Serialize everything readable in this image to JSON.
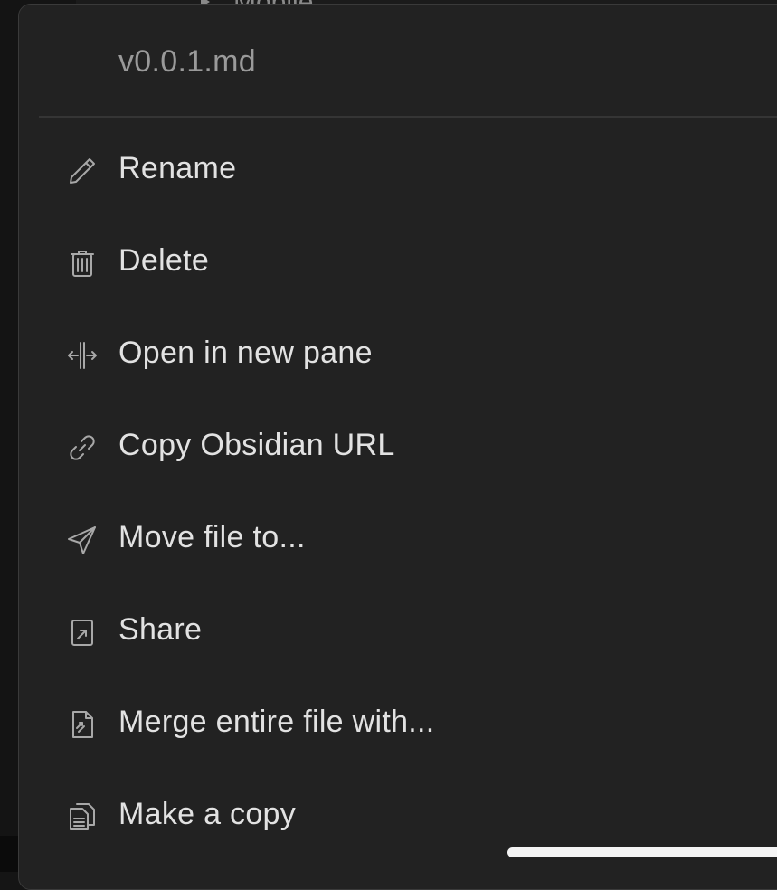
{
  "background": {
    "peek_text": "Mobile"
  },
  "menu": {
    "title": "v0.0.1.md",
    "items": [
      {
        "label": "Rename",
        "icon": "pencil-icon"
      },
      {
        "label": "Delete",
        "icon": "trash-icon"
      },
      {
        "label": "Open in new pane",
        "icon": "split-pane-icon"
      },
      {
        "label": "Copy Obsidian URL",
        "icon": "link-icon"
      },
      {
        "label": "Move file to...",
        "icon": "paper-plane-icon"
      },
      {
        "label": "Share",
        "icon": "share-icon"
      },
      {
        "label": "Merge entire file with...",
        "icon": "merge-file-icon"
      },
      {
        "label": "Make a copy",
        "icon": "copy-icon"
      }
    ]
  },
  "colors": {
    "menu_bg": "#222222",
    "text": "#e2e2e2",
    "title_text": "#9a9a9a",
    "icon": "#a8a8a8",
    "divider": "#353535"
  }
}
